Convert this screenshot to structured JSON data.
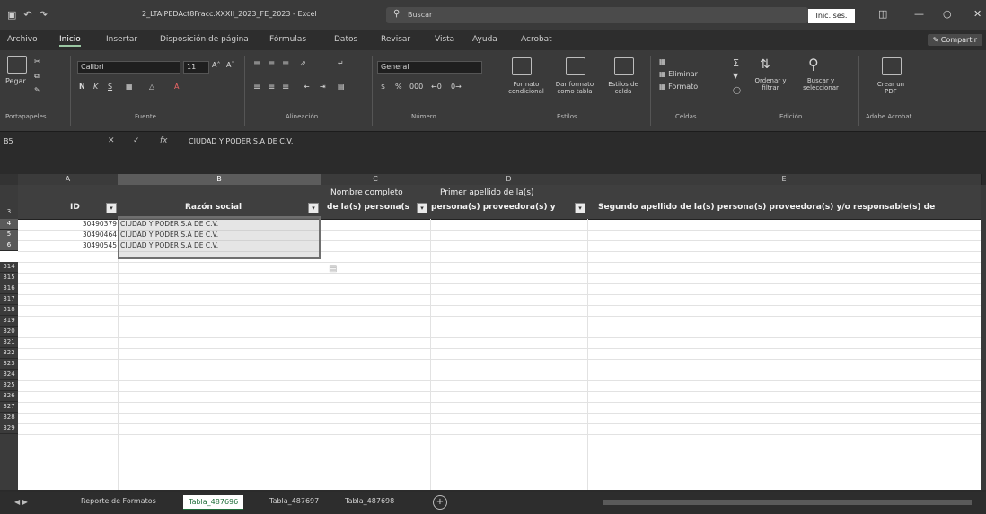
{
  "window": {
    "filename": "2_LTAIPEDAct8Fracc.XXXII_2023_FE_2023 - Excel",
    "search_placeholder": "Buscar",
    "signin_label": "Inic. ses.",
    "share_label": "Compartir"
  },
  "ribbon_tabs": [
    "Archivo",
    "Inicio",
    "Insertar",
    "Disposición de página",
    "Fórmulas",
    "Datos",
    "Revisar",
    "Vista",
    "Ayuda",
    "Acrobat"
  ],
  "ribbon": {
    "paste_label": "Pegar",
    "font_name": "Calibri",
    "font_size": "11",
    "number_format": "General",
    "bold": "N",
    "italic": "K",
    "underline": "S",
    "cond_format": "Formato condicional",
    "format_table": "Dar formato como tabla",
    "cell_styles": "Estilos de celda",
    "delete_label": "Eliminar",
    "format_label": "Formato",
    "sort_filter": "Ordenar y filtrar",
    "find_select": "Buscar y seleccionar",
    "create_pdf": "Crear un PDF",
    "groups": [
      "Portapapeles",
      "Fuente",
      "Alineación",
      "Número",
      "Estilos",
      "Celdas",
      "Edición",
      "Adobe Acrobat"
    ]
  },
  "formula_bar": {
    "cell_ref": "B5",
    "fx": "fx",
    "content": "CIUDAD Y PODER S.A DE C.V."
  },
  "columns": [
    "A",
    "B",
    "C",
    "D",
    "E"
  ],
  "table": {
    "headers": {
      "id": "ID",
      "razon_social": "Razón social",
      "nombre_completo_1": "Nombre completo",
      "nombre_completo_2": "de la(s) persona(s",
      "primer_apellido_1": "Primer apellido de la(s)",
      "primer_apellido_2": "persona(s) proveedora(s) y",
      "segundo_apellido": "Segundo apellido de la(s) persona(s) proveedora(s) y/o responsable(s) de"
    },
    "rows": [
      {
        "id": "30490379",
        "razon_social": "CIUDAD Y PODER S.A DE C.V."
      },
      {
        "id": "30490464",
        "razon_social": "CIUDAD Y PODER S.A DE C.V."
      },
      {
        "id": "30490545",
        "razon_social": "CIUDAD Y PODER S.A DE C.V."
      }
    ]
  },
  "row_numbers": [
    "3",
    "4",
    "5",
    "6",
    "314",
    "315",
    "316",
    "317",
    "318",
    "319",
    "320",
    "321",
    "322",
    "323",
    "324",
    "325",
    "326",
    "327",
    "328",
    "329"
  ],
  "sheet_tabs": [
    "Reporte de Formatos",
    "Tabla_487696",
    "Tabla_487697",
    "Tabla_487698"
  ],
  "active_sheet": "Tabla_487696"
}
